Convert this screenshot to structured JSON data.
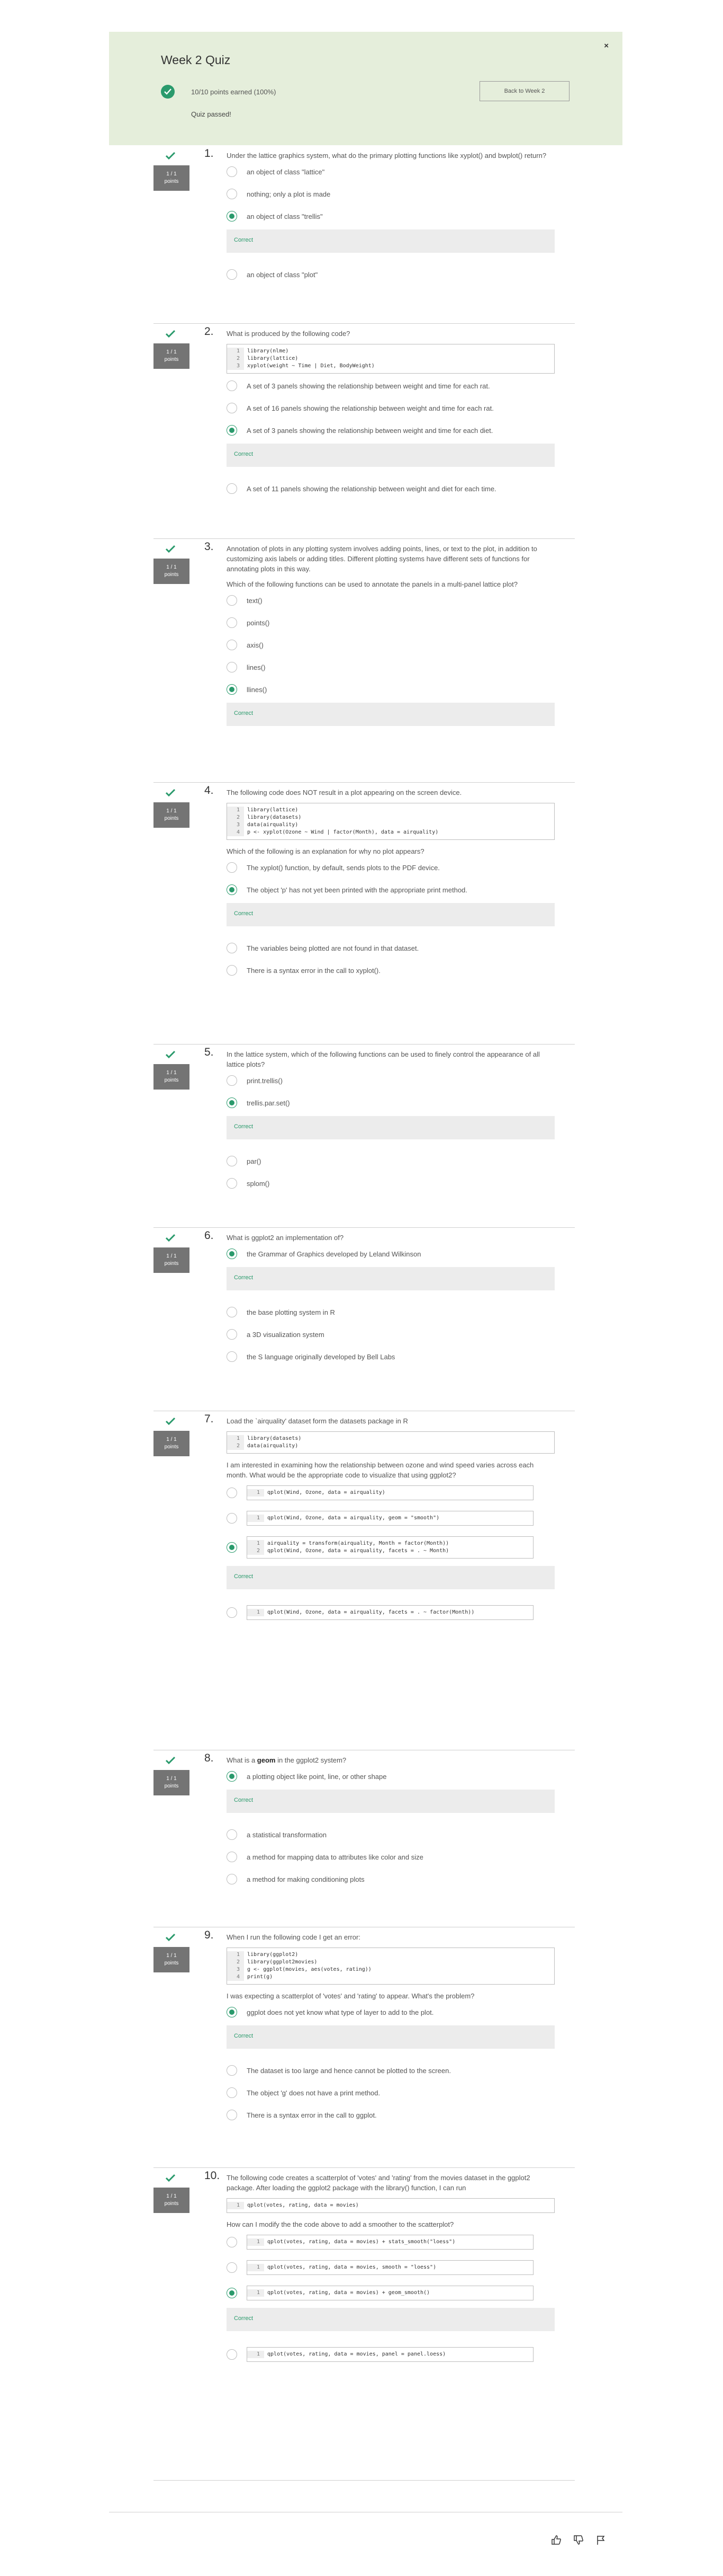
{
  "header": {
    "title": "Week 2 Quiz",
    "close": "×",
    "score": "10/10 points earned (100%)",
    "status": "Quiz passed!",
    "back_button": "Back to Week 2"
  },
  "badge_text": [
    "1 / 1",
    "points"
  ],
  "correct_label": "Correct",
  "questions": [
    {
      "number": "1.",
      "text": "Under the lattice graphics system, what do the primary plotting functions like xyplot() and bwplot() return?",
      "options": [
        {
          "label": "an object of class \"lattice\"",
          "selected": false
        },
        {
          "label": "nothing; only a plot is made",
          "selected": false
        },
        {
          "label": "an object of class \"trellis\"",
          "selected": true
        },
        {
          "label": "an object of class \"plot\"",
          "selected": false
        }
      ]
    },
    {
      "number": "2.",
      "text": "What is produced by the following code?",
      "code": [
        "library(nlme)",
        "library(lattice)",
        "xyplot(weight ~ Time | Diet, BodyWeight)"
      ],
      "options": [
        {
          "label": "A set of 3 panels showing the relationship between weight and time for each rat.",
          "selected": false
        },
        {
          "label": "A set of 16 panels showing the relationship between weight and time for each rat.",
          "selected": false
        },
        {
          "label": "A set of 3 panels showing the relationship between weight and time for each diet.",
          "selected": true
        },
        {
          "label": "A set of 11 panels showing the relationship between weight and diet for each time.",
          "selected": false
        }
      ]
    },
    {
      "number": "3.",
      "text": "Annotation of plots in any plotting system involves adding points, lines, or text to the plot, in addition to customizing axis labels or adding titles. Different plotting systems have different sets of functions for annotating plots in this way.",
      "text2": "Which of the following functions can be used to annotate the panels in a multi-panel lattice plot?",
      "options": [
        {
          "label": "text()",
          "selected": false
        },
        {
          "label": "points()",
          "selected": false
        },
        {
          "label": "axis()",
          "selected": false
        },
        {
          "label": "lines()",
          "selected": false
        },
        {
          "label": "llines()",
          "selected": true
        }
      ]
    },
    {
      "number": "4.",
      "text": "The following code does NOT result in a plot appearing on the screen device.",
      "code": [
        "library(lattice)",
        "library(datasets)",
        "data(airquality)",
        "p <- xyplot(Ozone ~ Wind | factor(Month), data = airquality)"
      ],
      "text2": "Which of the following is an explanation for why no plot appears?",
      "options": [
        {
          "label": "The xyplot() function, by default, sends plots to the PDF device.",
          "selected": false
        },
        {
          "label": "The object 'p' has not yet been printed with the appropriate print method.",
          "selected": true
        },
        {
          "label": "The variables being plotted are not found in that dataset.",
          "selected": false
        },
        {
          "label": "There is a syntax error in the call to xyplot().",
          "selected": false
        }
      ]
    },
    {
      "number": "5.",
      "text": "In the lattice system, which of the following functions can be used to finely control the appearance of all lattice plots?",
      "options": [
        {
          "label": "print.trellis()",
          "selected": false
        },
        {
          "label": "trellis.par.set()",
          "selected": true
        },
        {
          "label": "par()",
          "selected": false
        },
        {
          "label": "splom()",
          "selected": false
        }
      ]
    },
    {
      "number": "6.",
      "text": "What is ggplot2 an implementation of?",
      "options": [
        {
          "label": "the Grammar of Graphics developed by Leland Wilkinson",
          "selected": true
        },
        {
          "label": "the base plotting system in R",
          "selected": false
        },
        {
          "label": "a 3D visualization system",
          "selected": false
        },
        {
          "label": "the S language originally developed by Bell Labs",
          "selected": false
        }
      ]
    },
    {
      "number": "7.",
      "text": "Load the `airquality' dataset form the datasets package in R",
      "code": [
        "library(datasets)",
        "data(airquality)"
      ],
      "text2": "I am interested in examining how the relationship between ozone and wind speed varies across each month. What would be the appropriate code to visualize that using ggplot2?",
      "options": [
        {
          "code": [
            "qplot(Wind, Ozone, data = airquality)"
          ],
          "selected": false
        },
        {
          "code": [
            "qplot(Wind, Ozone, data = airquality, geom = \"smooth\")"
          ],
          "selected": false
        },
        {
          "code": [
            "airquality = transform(airquality, Month = factor(Month))",
            "qplot(Wind, Ozone, data = airquality, facets = . ~ Month)"
          ],
          "selected": true
        },
        {
          "code": [
            "qplot(Wind, Ozone, data = airquality, facets = . ~ factor(Month))"
          ],
          "selected": false
        }
      ]
    },
    {
      "number": "8.",
      "text_pre": "What is a ",
      "text_bold": "geom",
      "text_post": " in the ggplot2 system?",
      "options": [
        {
          "label": "a plotting object like point, line, or other shape",
          "selected": true
        },
        {
          "label": "a statistical transformation",
          "selected": false
        },
        {
          "label": "a method for mapping data to attributes like color and size",
          "selected": false
        },
        {
          "label": "a method for making conditioning plots",
          "selected": false
        }
      ]
    },
    {
      "number": "9.",
      "text": "When I run the following code I get an error:",
      "code": [
        "library(ggplot2)",
        "library(ggplot2movies)",
        "g <- ggplot(movies, aes(votes, rating))",
        "print(g)"
      ],
      "text2": "I was expecting a scatterplot of 'votes' and 'rating' to appear. What's the problem?",
      "options": [
        {
          "label": "ggplot does not yet know what type of layer to add to the plot.",
          "selected": true
        },
        {
          "label": "The dataset is too large and hence cannot be plotted to the screen.",
          "selected": false
        },
        {
          "label": "The object 'g' does not have a print method.",
          "selected": false
        },
        {
          "label": "There is a syntax error in the call to ggplot.",
          "selected": false
        }
      ]
    },
    {
      "number": "10.",
      "text": "The following code creates a scatterplot of 'votes' and 'rating' from the movies dataset in the ggplot2 package. After loading the ggplot2 package with the library() function, I can run",
      "code": [
        "qplot(votes, rating, data = movies)"
      ],
      "text2": "How can I modify the the code above to add a smoother to the scatterplot?",
      "options": [
        {
          "code": [
            "qplot(votes, rating, data = movies) + stats_smooth(\"loess\")"
          ],
          "selected": false
        },
        {
          "code": [
            "qplot(votes, rating, data = movies, smooth = \"loess\")"
          ],
          "selected": false
        },
        {
          "code": [
            "qplot(votes, rating, data = movies) + geom_smooth()"
          ],
          "selected": true
        },
        {
          "code": [
            "qplot(votes, rating, data = movies, panel = panel.loess)"
          ],
          "selected": false
        }
      ]
    }
  ],
  "footer_icons": [
    "thumbs-up-icon",
    "thumbs-down-icon",
    "flag-icon"
  ]
}
